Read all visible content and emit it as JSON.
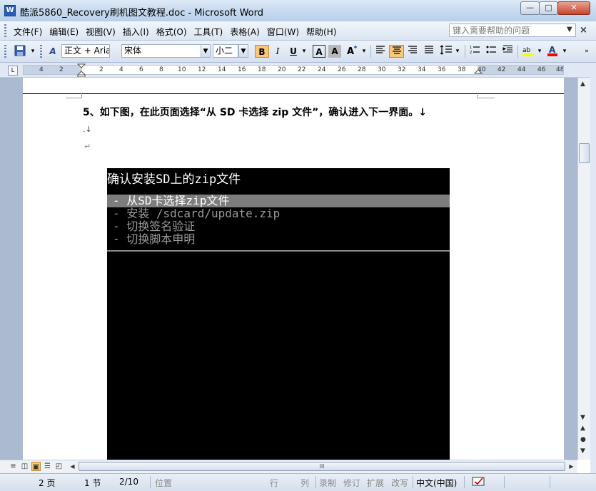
{
  "window": {
    "app_icon": "W",
    "title": "酷派5860_Recovery刷机图文教程.doc - Microsoft Word",
    "minimize": "—",
    "maximize": "□",
    "close": "✕"
  },
  "menu": {
    "items": [
      "文件(F)",
      "编辑(E)",
      "视图(V)",
      "插入(I)",
      "格式(O)",
      "工具(T)",
      "表格(A)",
      "窗口(W)",
      "帮助(H)"
    ],
    "help_placeholder": "键入需要帮助的问题",
    "close_doc": "×"
  },
  "toolbar": {
    "style": "正文 + Aria",
    "font": "宋体",
    "size": "小二",
    "bold": "B",
    "italic": "I",
    "underline": "U",
    "char_border": "A",
    "char_shading": "A",
    "icons": [
      "save-icon",
      "styles-icon",
      "char-scale-icon",
      "align-left-icon",
      "align-center-icon",
      "align-right-icon",
      "justify-icon",
      "line-spacing-icon",
      "numbering-icon",
      "bullets-icon",
      "indent-icon",
      "highlight-icon",
      "font-color-icon"
    ],
    "colors": {
      "highlight": "#ffff00",
      "font_color": "#ff0000",
      "active": "#f9c77b"
    }
  },
  "ruler": {
    "ticks": [
      "4",
      "2",
      "2",
      "4",
      "6",
      "8",
      "10",
      "12",
      "14",
      "16",
      "18",
      "20",
      "22",
      "24",
      "26",
      "28",
      "30",
      "32",
      "34",
      "36",
      "38",
      "40",
      "42",
      "44",
      "46",
      "48"
    ]
  },
  "document": {
    "step_text": "5、如下图，在此页面选择“从 SD 卡选择 zip 文件”，确认进入下一界面。↓",
    "mark1": ".↓",
    "mark2": "↵",
    "screen": {
      "title": "确认安装SD上的zip文件",
      "options": [
        "- 从SD卡选择zip文件",
        "- 安装 /sdcard/update.zip",
        "- 切换签名验证",
        "- 切换脚本申明"
      ],
      "selected_index": 0
    }
  },
  "hscroll": {
    "grip": "III"
  },
  "status": {
    "page": "2 页",
    "section": "1 节",
    "page_of": "2/10",
    "position": "位置",
    "line": "行",
    "column": "列",
    "rec": "录制",
    "trk": "修订",
    "ext": "扩展",
    "ovr": "改写",
    "language": "中文(中国)"
  }
}
